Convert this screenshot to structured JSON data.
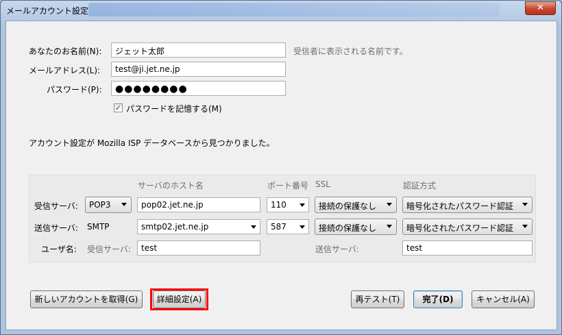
{
  "window": {
    "title": "メールアカウント設定",
    "close_symbol": "✕"
  },
  "identity": {
    "name_label": "あなたのお名前(N):",
    "name_value": "ジェット太郎",
    "name_hint": "受信者に表示される名前です。",
    "email_label": "メールアドレス(L):",
    "email_value": "test@ji.jet.ne.jp",
    "password_label": "パスワード(P):",
    "password_mask": "●●●●●●●●",
    "remember_label": "パスワードを記憶する(M)",
    "remember_checked": true
  },
  "status_message": "アカウント設定が Mozilla ISP データベースから見つかりました。",
  "server_table": {
    "headers": {
      "host": "サーバのホスト名",
      "port": "ポート番号",
      "ssl": "SSL",
      "auth": "認証方式"
    },
    "incoming": {
      "label": "受信サーバ:",
      "protocol": "POP3",
      "host": "pop02.jet.ne.jp",
      "port": "110",
      "ssl": "接続の保護なし",
      "auth": "暗号化されたパスワード認証"
    },
    "outgoing": {
      "label": "送信サーバ:",
      "protocol": "SMTP",
      "host": "smtp02.jet.ne.jp",
      "port": "587",
      "ssl": "接続の保護なし",
      "auth": "暗号化されたパスワード認証"
    },
    "username": {
      "label": "ユーザ名:",
      "incoming_label": "受信サーバ:",
      "incoming_value": "test",
      "outgoing_label": "送信サーバ:",
      "outgoing_value": "test"
    }
  },
  "buttons": {
    "new_account": "新しいアカウントを取得(G)",
    "advanced": "詳細設定(A)",
    "retest": "再テスト(T)",
    "done": "完了(D)",
    "cancel": "キャンセル(A)"
  },
  "colors": {
    "highlight": "#ff0000"
  }
}
